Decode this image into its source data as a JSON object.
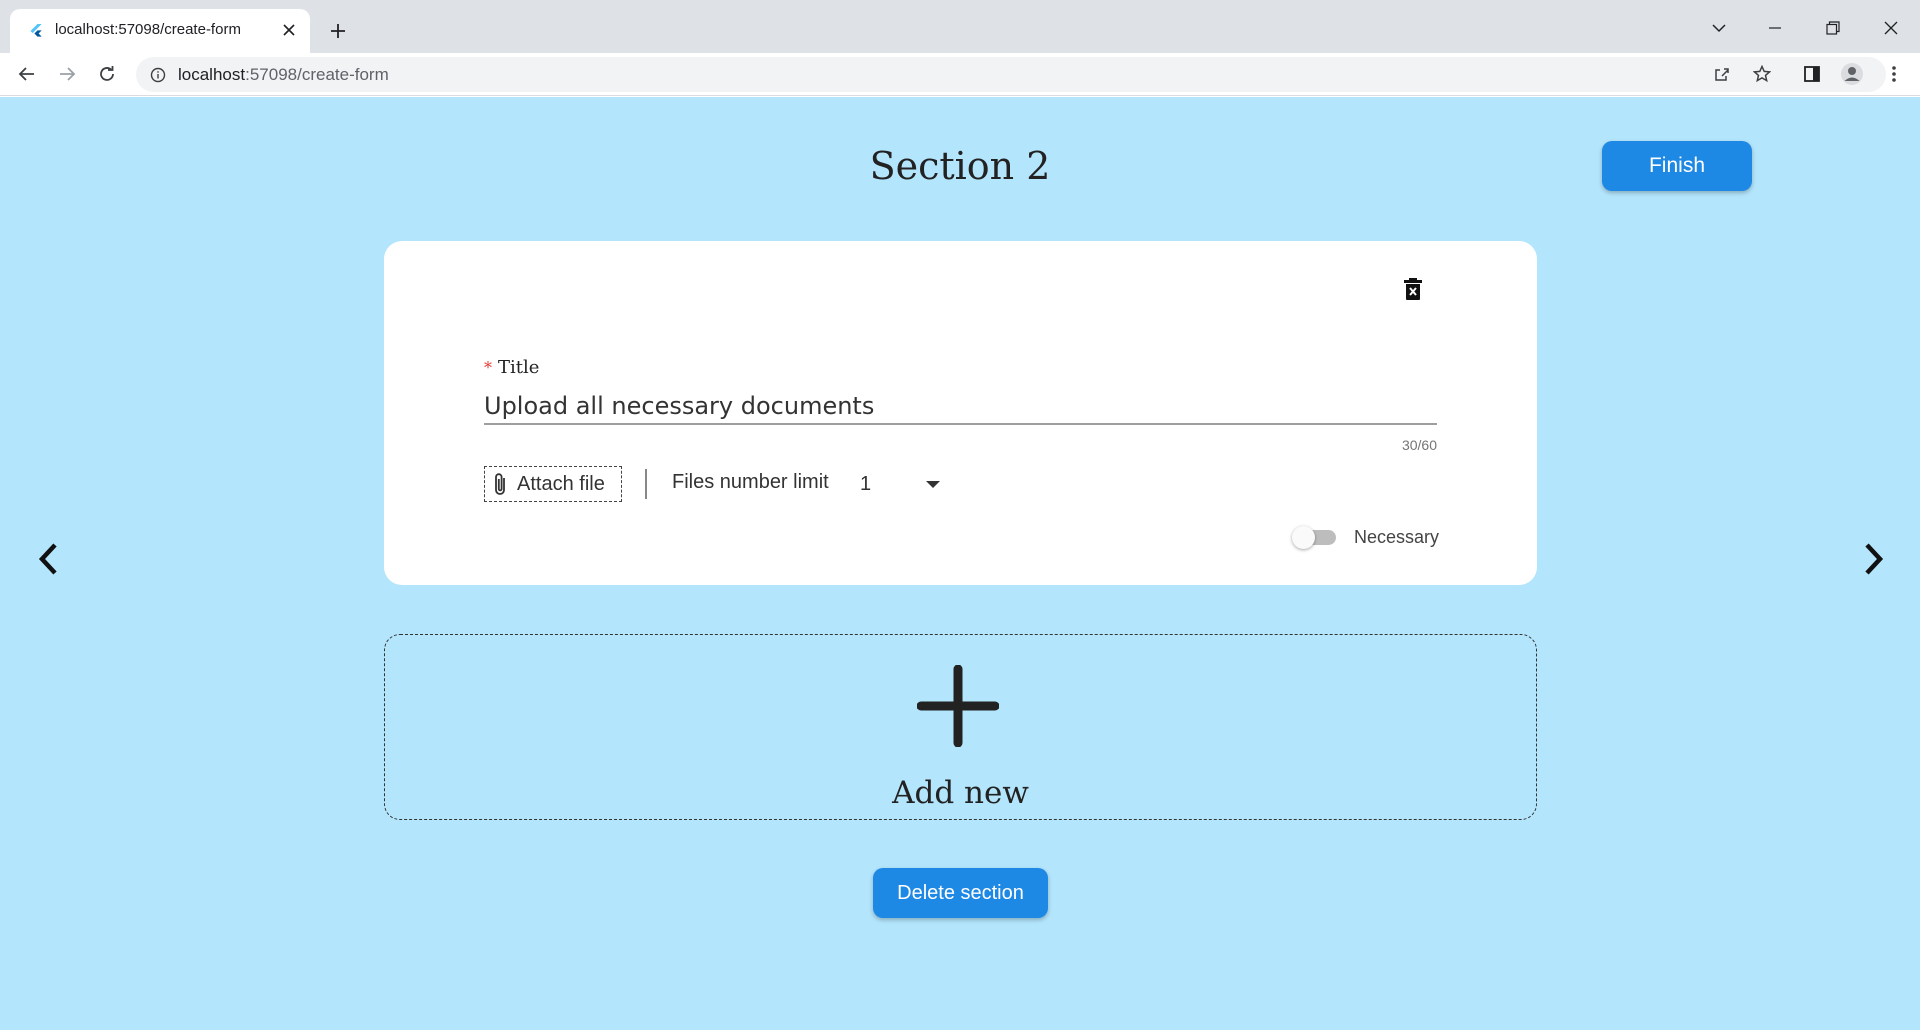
{
  "browser": {
    "tab_title": "localhost:57098/create-form",
    "url_host": "localhost",
    "url_path": ":57098/create-form",
    "icons": [
      "flutter-favicon-icon",
      "close-icon",
      "plus-icon",
      "chevron-down-icon",
      "minimize-icon",
      "restore-icon",
      "close-window-icon",
      "back-arrow-icon",
      "forward-arrow-icon",
      "reload-icon",
      "info-icon",
      "share-icon",
      "star-icon",
      "side-panel-icon",
      "profile-icon",
      "kebab-menu-icon"
    ]
  },
  "page": {
    "section_title": "Section 2",
    "finish_label": "Finish",
    "background_color": "#b3e5fc",
    "accent_color": "#1e88e5"
  },
  "question": {
    "required_marker": "*",
    "title_label": "Title",
    "title_value": "Upload all necessary documents",
    "char_counter": "30/60",
    "attach_label": "Attach file",
    "files_limit_label": "Files number limit",
    "files_limit_value": "1",
    "necessary_label": "Necessary",
    "necessary_on": false
  },
  "add_new": {
    "label": "Add new"
  },
  "footer": {
    "delete_section_label": "Delete section"
  }
}
